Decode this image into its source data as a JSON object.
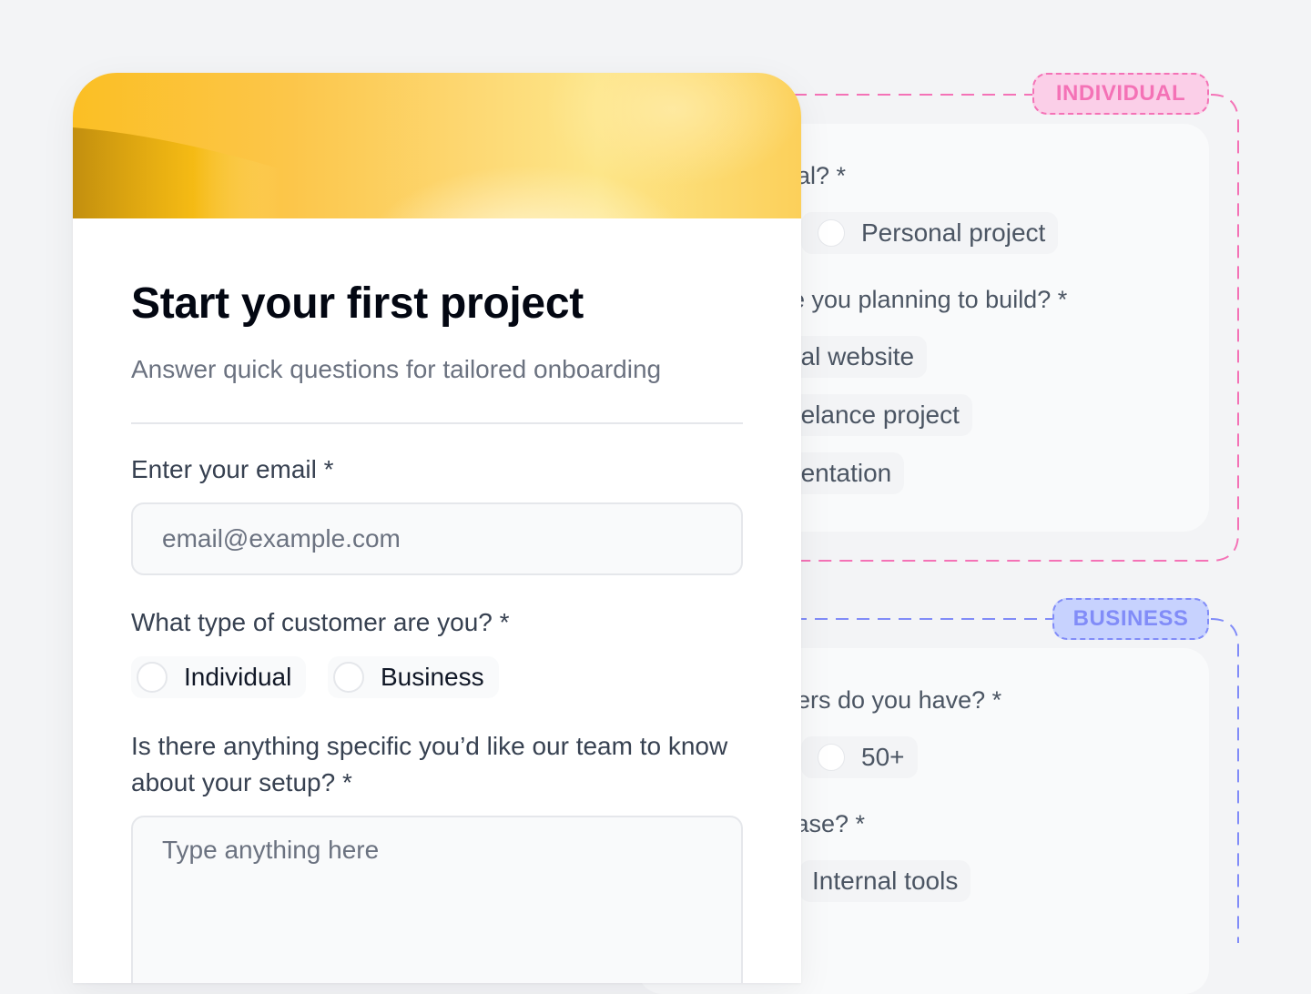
{
  "form": {
    "title": "Start your first project",
    "subtitle": "Answer quick questions for tailored onboarding",
    "email_label": "Enter your email *",
    "email_placeholder": "email@example.com",
    "customer_label": "What type of customer are you? *",
    "customer_options": [
      "Individual",
      "Business"
    ],
    "setup_label": "Is there anything specific you’d like our team to know about your setup? *",
    "setup_placeholder": "Type anything here"
  },
  "branches": {
    "individual": {
      "tag": "INDIVIDUAL",
      "tag_color": "#f472b6",
      "question_1": "oal? *",
      "option_1": "Personal project",
      "question_2": "re you planning to build? *",
      "options_2": [
        "nal website",
        "eelance project",
        "nentation"
      ]
    },
    "business": {
      "tag": "BUSINESS",
      "tag_color": "#818cf8",
      "question_1": "bers do you have? *",
      "option_1": "50+",
      "question_2": "case? *",
      "option_2": "Internal tools"
    }
  },
  "colors": {
    "background": "#f3f4f6",
    "banner_accent": "#fbbf24"
  }
}
